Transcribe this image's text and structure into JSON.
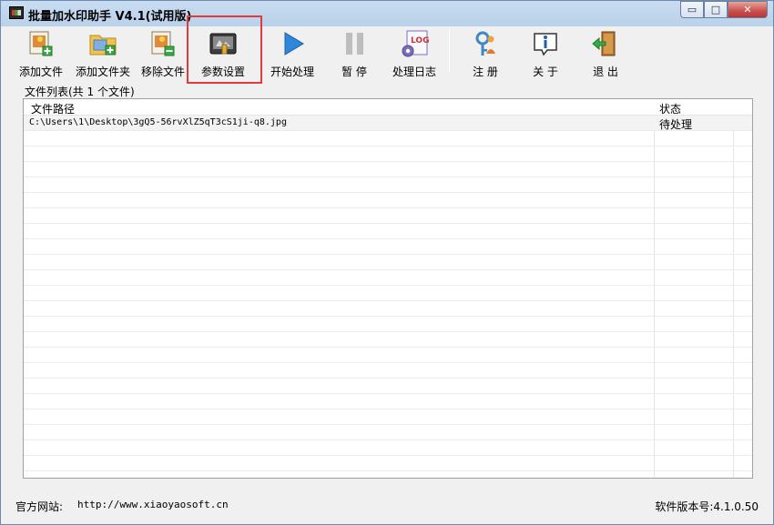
{
  "window": {
    "title": "批量加水印助手 V4.1(试用版)",
    "controls": {
      "minimize": "▭",
      "maximize": "□",
      "close": "✕"
    }
  },
  "toolbar": {
    "add_file": "添加文件",
    "add_folder": "添加文件夹",
    "remove_file": "移除文件",
    "settings": "参数设置",
    "start": "开始处理",
    "pause": "暂 停",
    "log": "处理日志",
    "register": "注 册",
    "about": "关 于",
    "exit": "退 出"
  },
  "file_list": {
    "group_label": "文件列表(共 1 个文件)",
    "columns": {
      "path": "文件路径",
      "status": "状态"
    },
    "rows": [
      {
        "path": "C:\\Users\\1\\Desktop\\3gQ5-56rvXlZ5qT3cS1ji-q8.jpg",
        "status": "待处理"
      }
    ]
  },
  "status_bar": {
    "site_label": "官方网站:",
    "site_url": "http://www.xiaoyaosoft.cn",
    "version": "软件版本号:4.1.0.50"
  },
  "colors": {
    "highlight": "#e23b3b",
    "title_gradient": "#b9d1ea",
    "play_blue": "#2e87d8"
  }
}
